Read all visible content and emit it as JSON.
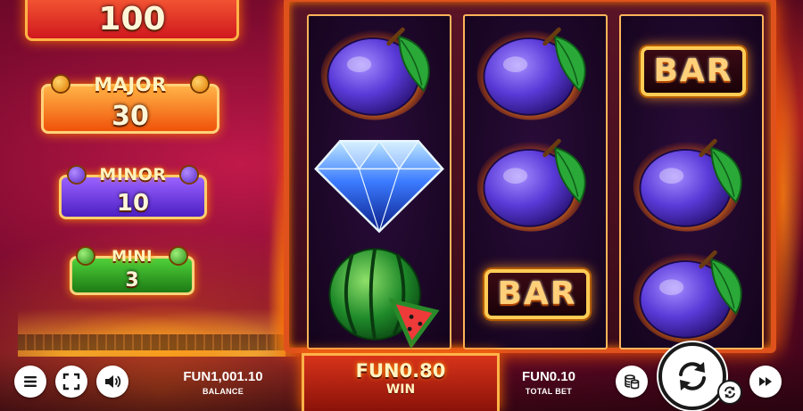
{
  "jackpots": {
    "grand": {
      "value": "100"
    },
    "major": {
      "title": "MAJOR",
      "value": "30"
    },
    "minor": {
      "title": "MINOR",
      "value": "10"
    },
    "mini": {
      "title": "MINI",
      "value": "3"
    }
  },
  "reels": [
    [
      "plum",
      "diamond",
      "watermelon"
    ],
    [
      "plum",
      "plum",
      "bar"
    ],
    [
      "bar",
      "plum",
      "plum"
    ]
  ],
  "symbols": {
    "bar_label": "BAR"
  },
  "bottom_bar": {
    "balance_value": "FUN1,001.10",
    "balance_label": "BALANCE",
    "win_value": "FUN0.80",
    "win_label": "WIN",
    "total_bet_value": "FUN0.10",
    "total_bet_label": "TOTAL BET"
  },
  "icons": {
    "menu": "menu-icon",
    "fullscreen": "fullscreen-icon",
    "sound": "speaker-icon",
    "coins": "coin-stack-icon",
    "spin": "spin-arrows-icon",
    "autoplay": "autoplay-icon",
    "turbo": "fast-forward-icon"
  },
  "colors": {
    "frame": "#e0521c",
    "grand": "#d0181e",
    "major": "#f0520a",
    "minor": "#4d1fc4",
    "mini": "#1d7a14",
    "win_panel": "#d8331a"
  }
}
